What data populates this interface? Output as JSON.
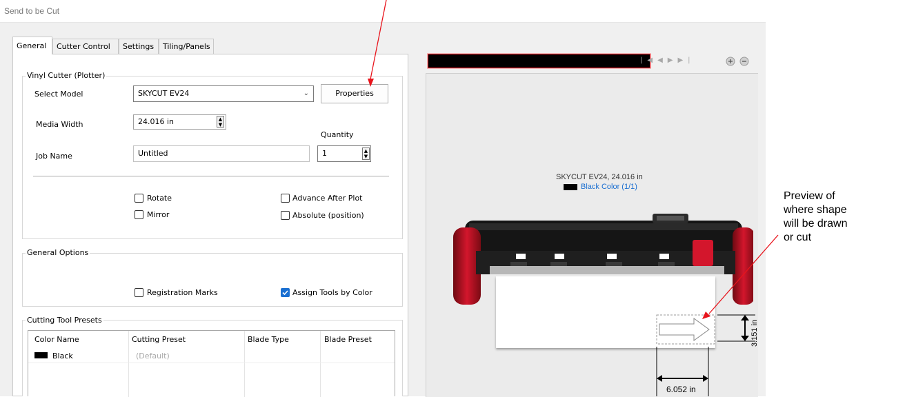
{
  "window": {
    "title": "Send to be Cut"
  },
  "tabs": [
    {
      "label": "General",
      "active": true
    },
    {
      "label": "Cutter Control",
      "active": false
    },
    {
      "label": "Settings",
      "active": false
    },
    {
      "label": "Tiling/Panels",
      "active": false
    }
  ],
  "vinyl": {
    "group_label": "Vinyl Cutter (Plotter)",
    "select_model_label": "Select Model",
    "select_model_value": "SKYCUT EV24",
    "properties_label": "Properties",
    "media_width_label": "Media Width",
    "media_width_value": "24.016 in",
    "quantity_label": "Quantity",
    "quantity_value": "1",
    "job_name_label": "Job Name",
    "job_name_value": "Untitled",
    "rotate_label": "Rotate",
    "mirror_label": "Mirror",
    "advance_label": "Advance After Plot",
    "absolute_label": "Absolute (position)"
  },
  "general_options": {
    "group_label": "General Options",
    "registration_label": "Registration Marks",
    "assign_tools_label": "Assign Tools by Color",
    "assign_tools_checked": true
  },
  "presets": {
    "group_label": "Cutting Tool Presets",
    "headers": [
      "Color Name",
      "Cutting Preset",
      "Blade Type",
      "Blade Preset"
    ],
    "rows": [
      {
        "color_hex": "#000000",
        "name": "Black",
        "preset": "(Default)",
        "blade_type": "",
        "blade_preset": ""
      }
    ]
  },
  "preview": {
    "caption_model": "SKYCUT EV24,  24.016 in",
    "color_label": "Black Color (1/1)",
    "color_swatch": "#000000",
    "dim_height": "3.151 in",
    "dim_width": "6.052 in",
    "nav_first": "⏮",
    "nav_prev": "◀",
    "nav_next": "▶",
    "nav_last": "⏭",
    "zoom_in": "+",
    "zoom_out": "−"
  },
  "annotation": {
    "line1": "Preview of",
    "line2": "where shape",
    "line3": "will be drawn",
    "line4": "or cut"
  },
  "colors": {
    "accent": "#1a6fd1",
    "arrow": "#e8141c",
    "cutter_red": "#c8102e",
    "progress_bar": "#000000",
    "progress_border": "#e0202a"
  }
}
